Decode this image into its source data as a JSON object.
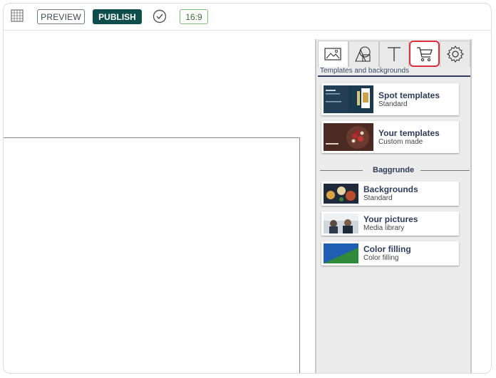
{
  "toolbar": {
    "grid_icon": "grid-icon",
    "preview_label": "PREVIEW",
    "publish_label": "PUBLISH",
    "check_icon": "check-circle-icon",
    "ratio_label": "16:9",
    "publish_color": "#0f4c4c"
  },
  "panel": {
    "tabs": [
      {
        "icon": "image-icon"
      },
      {
        "icon": "shapes-icon"
      },
      {
        "icon": "text-icon"
      },
      {
        "icon": "cart-icon"
      },
      {
        "icon": "gear-icon"
      }
    ],
    "subtitle": "Templates and backgrounds",
    "templates": [
      {
        "title": "Spot templates",
        "subtitle": "Standard"
      },
      {
        "title": "Your templates",
        "subtitle": "Custom made"
      }
    ],
    "section_label": "Baggrunde",
    "backgrounds": [
      {
        "title": "Backgrounds",
        "subtitle": "Standard"
      },
      {
        "title": "Your pictures",
        "subtitle": "Media library"
      },
      {
        "title": "Color filling",
        "subtitle": "Color filling"
      }
    ],
    "highlight_color": "#d9303b"
  }
}
